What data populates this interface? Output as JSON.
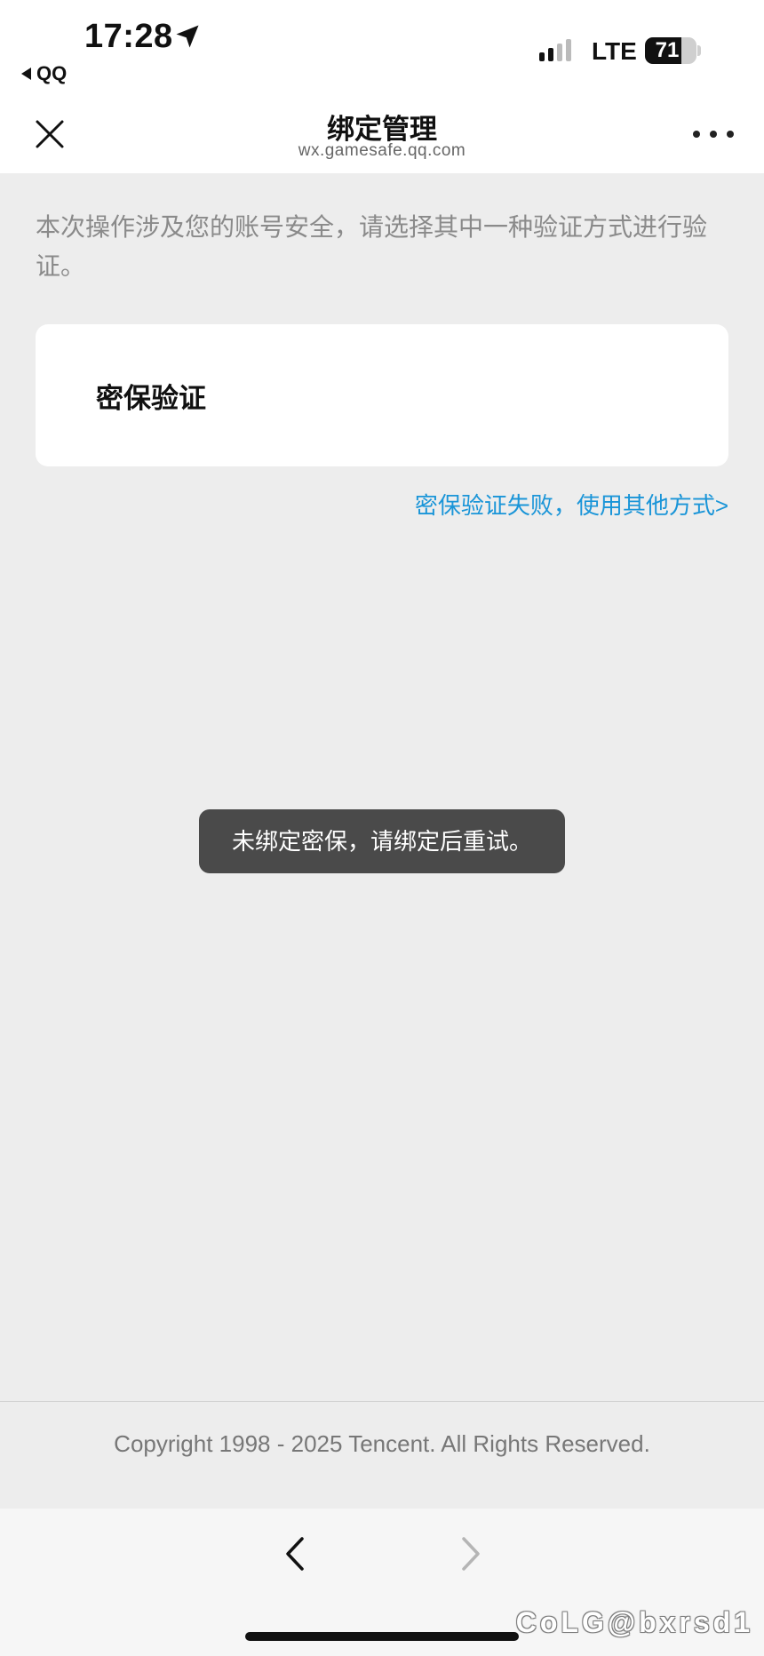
{
  "status_bar": {
    "time": "17:28",
    "back_app": "QQ",
    "network": "LTE",
    "battery": "71",
    "battery_level": 0.71,
    "signal_bars_active": 2,
    "signal_bars_total": 4
  },
  "header": {
    "title": "绑定管理",
    "subtitle": "wx.gamesafe.qq.com"
  },
  "main": {
    "notice": "本次操作涉及您的账号安全，请选择其中一种验证方式进行验证。",
    "option_label": "密保验证",
    "alt_link": "密保验证失败，使用其他方式>"
  },
  "toast": {
    "message": "未绑定密保，请绑定后重试。"
  },
  "footer": {
    "copyright": "Copyright 1998 - 2025 Tencent. All Rights Reserved."
  },
  "watermark": "CoLG@bxrsd1",
  "colors": {
    "link": "#1a95d8",
    "page_bg": "#ededed",
    "toast_bg": "#4a4a4a"
  },
  "icons": {
    "close": "close-icon",
    "more": "more-icon",
    "back": "chevron-left-icon",
    "forward": "chevron-right-icon",
    "location": "location-arrow-icon"
  }
}
